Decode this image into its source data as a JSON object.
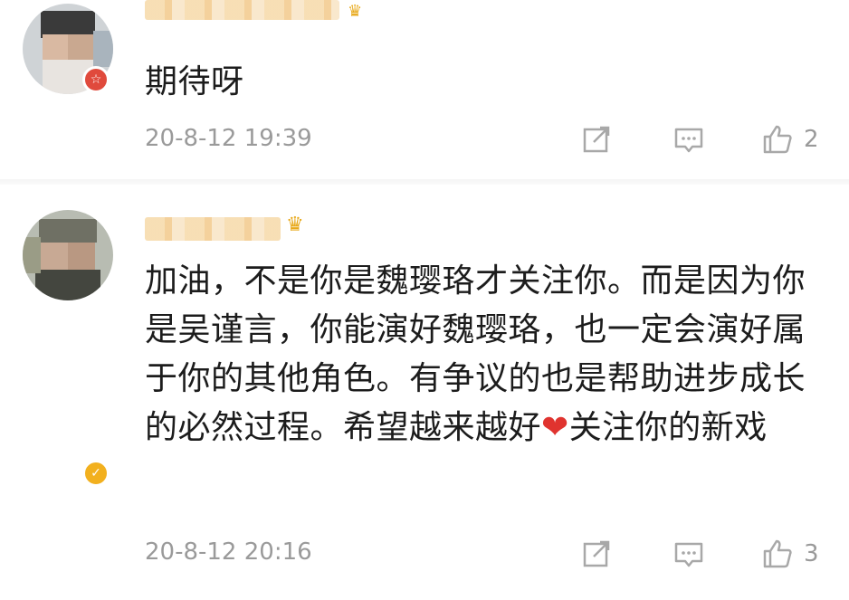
{
  "comments": [
    {
      "badge_icon": "star-icon",
      "badge_color": "#e04a3c",
      "text": "期待呀",
      "time": "20-8-12 19:39",
      "likes": "2"
    },
    {
      "badge_icon": "checkmark-icon",
      "badge_color": "#f2b01e",
      "text": "加油，不是你是魏璎珞才关注你。而是因为你是吴谨言，你能演好魏璎珞，也一定会演好属于你的其他角色。有争议的也是帮助进步成长的必然过程。希望越来越好",
      "heart": "❤",
      "text_tail": "关注你的新戏",
      "time": "20-8-12 20:16",
      "likes": "3"
    }
  ]
}
